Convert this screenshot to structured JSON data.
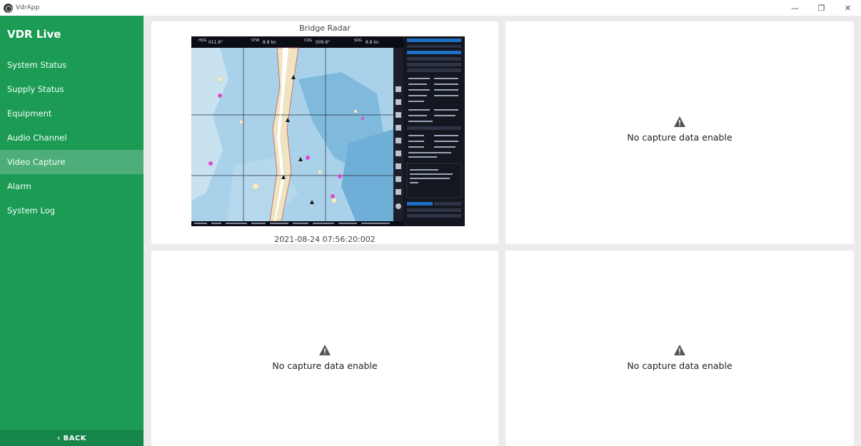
{
  "window": {
    "title": "VdrApp",
    "minimize_glyph": "—",
    "restore_glyph": "❐",
    "close_glyph": "✕"
  },
  "sidebar": {
    "header": "VDR Live",
    "items": [
      {
        "label": "System Status",
        "active": false
      },
      {
        "label": "Supply Status",
        "active": false
      },
      {
        "label": "Equipment",
        "active": false
      },
      {
        "label": "Audio Channel",
        "active": false
      },
      {
        "label": "Video Capture",
        "active": true
      },
      {
        "label": "Alarm",
        "active": false
      },
      {
        "label": "System Log",
        "active": false
      }
    ],
    "back_label": "‹  BACK"
  },
  "captures": [
    {
      "title": "Bridge Radar",
      "timestamp": "2021-08-24 07:56:20:002",
      "has_data": true
    },
    {
      "message": "No capture data enable",
      "has_data": false
    },
    {
      "message": "No capture data enable",
      "has_data": false
    },
    {
      "message": "No capture data enable",
      "has_data": false
    }
  ],
  "radar_header": [
    {
      "label": "HDG",
      "value": "011.6°"
    },
    {
      "label": "STW",
      "value": "8.8 kn"
    },
    {
      "label": "COG",
      "value": "009.8°"
    },
    {
      "label": "SOG",
      "value": "8.8 kn"
    }
  ],
  "colors": {
    "sidebar": "#1c9b55",
    "sidebar_active": "#4dae7a",
    "sidebar_back": "#15854a",
    "background": "#ebebeb",
    "panel": "#ffffff",
    "warning": "#555555"
  },
  "icons": {
    "warning": "warning-triangle-icon",
    "app": "app-logo-icon"
  }
}
